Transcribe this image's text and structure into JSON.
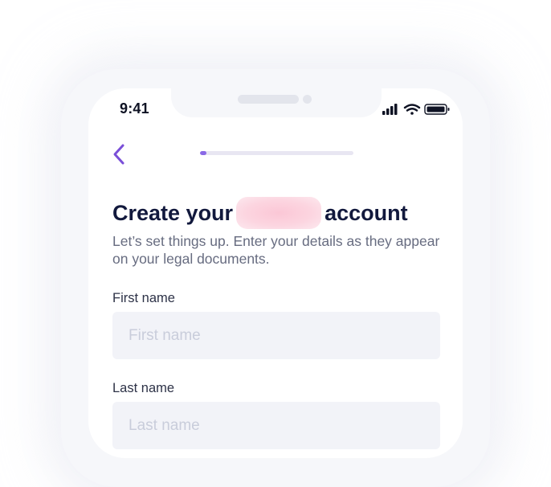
{
  "status_bar": {
    "time": "9:41",
    "icons": [
      "signal-icon",
      "wifi-icon",
      "battery-icon"
    ]
  },
  "nav": {
    "back_icon": "chevron-left-icon",
    "progress": 0.04
  },
  "header": {
    "title_prefix": "Create your",
    "title_suffix": "account",
    "subtitle": "Let’s set things up. Enter your details as they appear on your legal documents."
  },
  "form": {
    "first_name": {
      "label": "First name",
      "placeholder": "First name",
      "value": ""
    },
    "last_name": {
      "label": "Last name",
      "placeholder": "Last name",
      "value": ""
    }
  },
  "colors": {
    "accent": "#7a4fd8",
    "progress_fill": "#8a69e6",
    "title": "#12193d",
    "field_bg": "#f2f3f8"
  }
}
